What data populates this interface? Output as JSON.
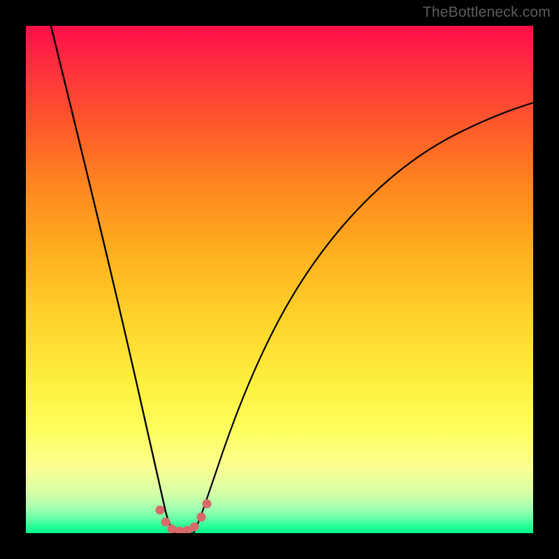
{
  "watermark": "TheBottleneck.com",
  "colors": {
    "background": "#000000",
    "curve": "#000000",
    "dots": "#d96a6a"
  },
  "chart_data": {
    "type": "line",
    "title": "",
    "xlabel": "",
    "ylabel": "",
    "xlim": [
      0,
      100
    ],
    "ylim": [
      0,
      100
    ],
    "note": "Axes are unlabeled in the source image; values below are estimated from pixel position on a 0–100 normalized scale where x=0 is left edge, y=0 is bottom edge of the gradient plot area.",
    "series": [
      {
        "name": "left-branch",
        "x": [
          5,
          8,
          12,
          16,
          20,
          22,
          24,
          25,
          26,
          27,
          28,
          29
        ],
        "y": [
          100,
          86,
          66,
          46,
          26,
          16,
          8,
          5,
          3,
          1.5,
          0.5,
          0
        ]
      },
      {
        "name": "right-branch",
        "x": [
          33,
          34,
          35,
          36,
          38,
          41,
          45,
          50,
          56,
          63,
          72,
          82,
          92,
          100
        ],
        "y": [
          0,
          1,
          3,
          6,
          12,
          22,
          34,
          46,
          56,
          64,
          72,
          78,
          82,
          85
        ]
      },
      {
        "name": "trough-floor",
        "x": [
          29,
          30,
          31,
          32,
          33
        ],
        "y": [
          0,
          0,
          0,
          0,
          0
        ]
      }
    ],
    "markers": [
      {
        "x": 26.5,
        "y": 4.5
      },
      {
        "x": 27.5,
        "y": 2.2
      },
      {
        "x": 28.8,
        "y": 0.8
      },
      {
        "x": 30.3,
        "y": 0.4
      },
      {
        "x": 31.8,
        "y": 0.5
      },
      {
        "x": 33.2,
        "y": 1.2
      },
      {
        "x": 34.6,
        "y": 3.2
      },
      {
        "x": 35.7,
        "y": 5.8
      }
    ]
  }
}
